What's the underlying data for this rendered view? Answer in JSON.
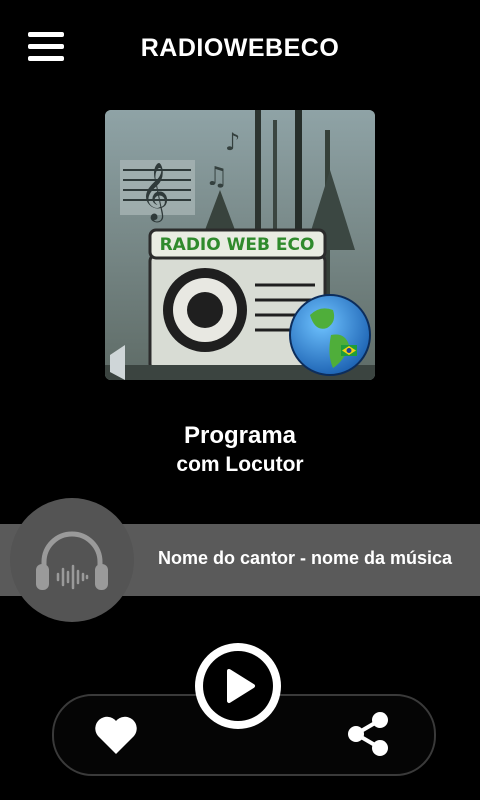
{
  "header": {
    "menu_icon": "hamburger-menu-icon",
    "title": "RADIOWEBECO"
  },
  "cover": {
    "logo_text": "RADIO WEB ECO"
  },
  "program": {
    "name": "Programa",
    "host": "com Locutor"
  },
  "now_playing": {
    "track": "Nome do cantor - nome da música",
    "icon": "headphones-icon"
  },
  "controls": {
    "like_icon": "heart-icon",
    "play_icon": "play-icon",
    "share_icon": "share-icon"
  },
  "colors": {
    "background": "#000000",
    "bar": "#5a5a5a",
    "disc": "#545454",
    "accent": "#ffffff"
  }
}
